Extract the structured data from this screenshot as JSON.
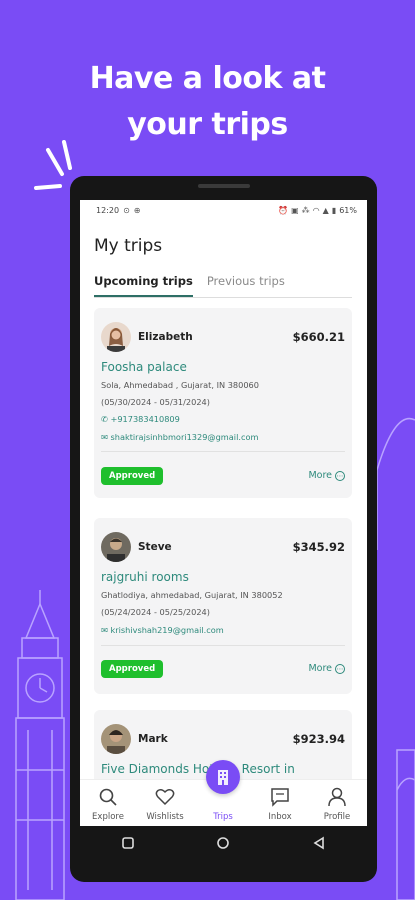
{
  "headline": {
    "line1": "Have a look at",
    "line2": "your trips"
  },
  "status_bar": {
    "time": "12:20",
    "battery": "61%"
  },
  "page": {
    "title": "My trips"
  },
  "tabs": [
    {
      "label": "Upcoming trips",
      "active": true
    },
    {
      "label": "Previous trips",
      "active": false
    }
  ],
  "trips": [
    {
      "guest": "Elizabeth",
      "price": "$660.21",
      "hotel": "Foosha palace",
      "address": "Sola, Ahmedabad , Gujarat, IN 380060",
      "dates": "(05/30/2024 - 05/31/2024)",
      "phone": "+917383410809",
      "email": "shaktirajsinhbmori1329@gmail.com",
      "status": "Approved",
      "more": "More"
    },
    {
      "guest": "Steve",
      "price": "$345.92",
      "hotel": "rajgruhi rooms",
      "address": "Ghatlodiya, ahmedabad, Gujarat, IN 380052",
      "dates": "(05/24/2024 - 05/25/2024)",
      "email": "krishivshah219@gmail.com",
      "status": "Approved",
      "more": "More"
    },
    {
      "guest": "Mark",
      "price": "$923.94",
      "hotel": "Five Diamonds Hotel & Resort in"
    }
  ],
  "bottom_nav": [
    {
      "label": "Explore",
      "icon": "search-icon"
    },
    {
      "label": "Wishlists",
      "icon": "heart-icon"
    },
    {
      "label": "Trips",
      "icon": "building-icon",
      "active": true
    },
    {
      "label": "Inbox",
      "icon": "message-icon"
    },
    {
      "label": "Profile",
      "icon": "person-icon"
    }
  ],
  "colors": {
    "background": "#7a4cf5",
    "accent": "#2e8a7c",
    "approved": "#1fbf2d",
    "tab_underline": "#2e6f66"
  }
}
